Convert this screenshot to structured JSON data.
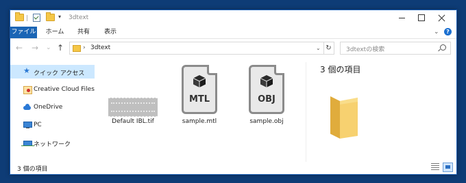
{
  "window": {
    "title": "3dtext"
  },
  "ribbon": {
    "tabs": [
      "ファイル",
      "ホーム",
      "共有",
      "表示"
    ]
  },
  "address": {
    "separator": "›",
    "path": "3dtext",
    "dropdown": "⌄",
    "refresh": "↻"
  },
  "search": {
    "placeholder": "3dtextの検索"
  },
  "navigation": {
    "back": "←",
    "forward": "→",
    "recent": "⌄",
    "up": "↑"
  },
  "sidebar": {
    "items": [
      {
        "label": "クイック アクセス",
        "icon": "star-icon",
        "selected": true
      },
      {
        "label": "Creative Cloud Files",
        "icon": "creative-cloud-folder-icon"
      },
      {
        "label": "OneDrive",
        "icon": "cloud-icon"
      },
      {
        "label": "PC",
        "icon": "computer-icon"
      },
      {
        "label": "ネットワーク",
        "icon": "network-icon"
      }
    ]
  },
  "files": [
    {
      "name": "Default IBL.tif",
      "type": "tif",
      "icon": "image-file-icon"
    },
    {
      "name": "sample.mtl",
      "badge": "MTL",
      "icon": "mtl-file-icon"
    },
    {
      "name": "sample.obj",
      "badge": "OBJ",
      "icon": "obj-file-icon"
    }
  ],
  "preview": {
    "title": "3 個の項目",
    "icon": "folder-icon"
  },
  "status": {
    "text": "3 個の項目"
  },
  "colors": {
    "accent": "#1a65b5",
    "selection": "#cce8ff",
    "folder": "#f5c747"
  }
}
